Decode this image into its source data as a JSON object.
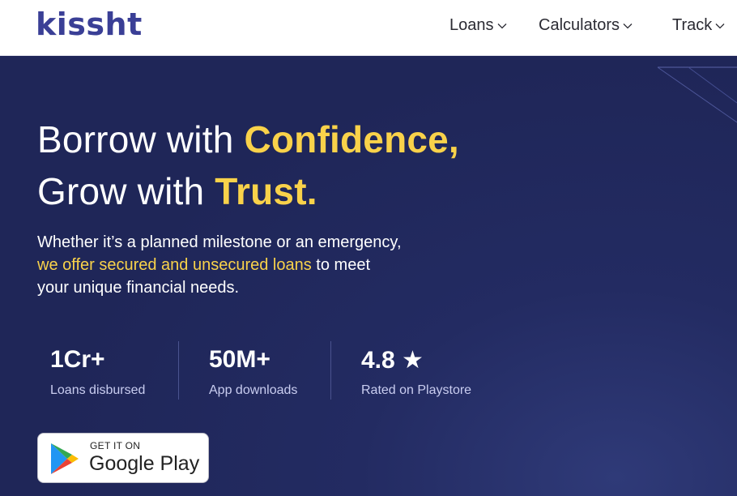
{
  "brand": {
    "name": "kissht"
  },
  "nav": {
    "items": [
      {
        "label": "Loans"
      },
      {
        "label": "Calculators"
      },
      {
        "label": "Track"
      }
    ]
  },
  "hero": {
    "line1_prefix": "Borrow with ",
    "line1_accent": "Confidence,",
    "line2_prefix": "Grow with ",
    "line2_accent": "Trust.",
    "sub_line1": "Whether it’s a planned milestone or an emergency,",
    "sub_line2_accent": "we offer secured and unsecured loans",
    "sub_line2_rest": " to meet",
    "sub_line3": "your unique financial needs."
  },
  "stats": [
    {
      "value": "1Cr+",
      "label": "Loans disbursed"
    },
    {
      "value": "50M+",
      "label": "App downloads"
    },
    {
      "value": "4.8 ★",
      "label": "Rated on Playstore"
    }
  ],
  "play_store": {
    "small_text": "GET IT ON",
    "big_text": "Google Play"
  },
  "colors": {
    "brand": "#3a3f96",
    "accent": "#f9d24a",
    "hero_bg": "#232b62"
  }
}
